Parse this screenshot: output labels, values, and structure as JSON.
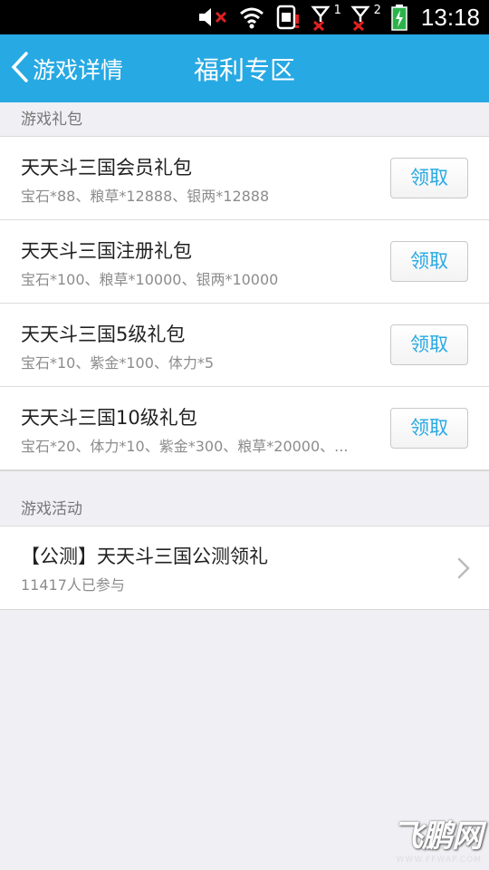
{
  "status_bar": {
    "time": "13:18",
    "signal1_label": "1",
    "signal2_label": "2"
  },
  "top_bar": {
    "back_label": "游戏详情",
    "title": "福利专区",
    "bg_color": "#27a9e3"
  },
  "gifts_section": {
    "header": "游戏礼包",
    "items": [
      {
        "name": "天天斗三国会员礼包",
        "desc": "宝石*88、粮草*12888、银两*12888",
        "button": "领取"
      },
      {
        "name": "天天斗三国注册礼包",
        "desc": "宝石*100、粮草*10000、银两*10000",
        "button": "领取"
      },
      {
        "name": "天天斗三国5级礼包",
        "desc": "宝石*10、紫金*100、体力*5",
        "button": "领取"
      },
      {
        "name": "天天斗三国10级礼包",
        "desc": "宝石*20、体力*10、紫金*300、粮草*20000、...",
        "button": "领取"
      }
    ]
  },
  "activities_section": {
    "header": "游戏活动",
    "items": [
      {
        "title": "【公测】天天斗三国公测领礼",
        "participants": "11417人已参与"
      }
    ]
  },
  "watermark": {
    "text": "飞鹏网",
    "url": "WWW.FFWAP.COM"
  }
}
